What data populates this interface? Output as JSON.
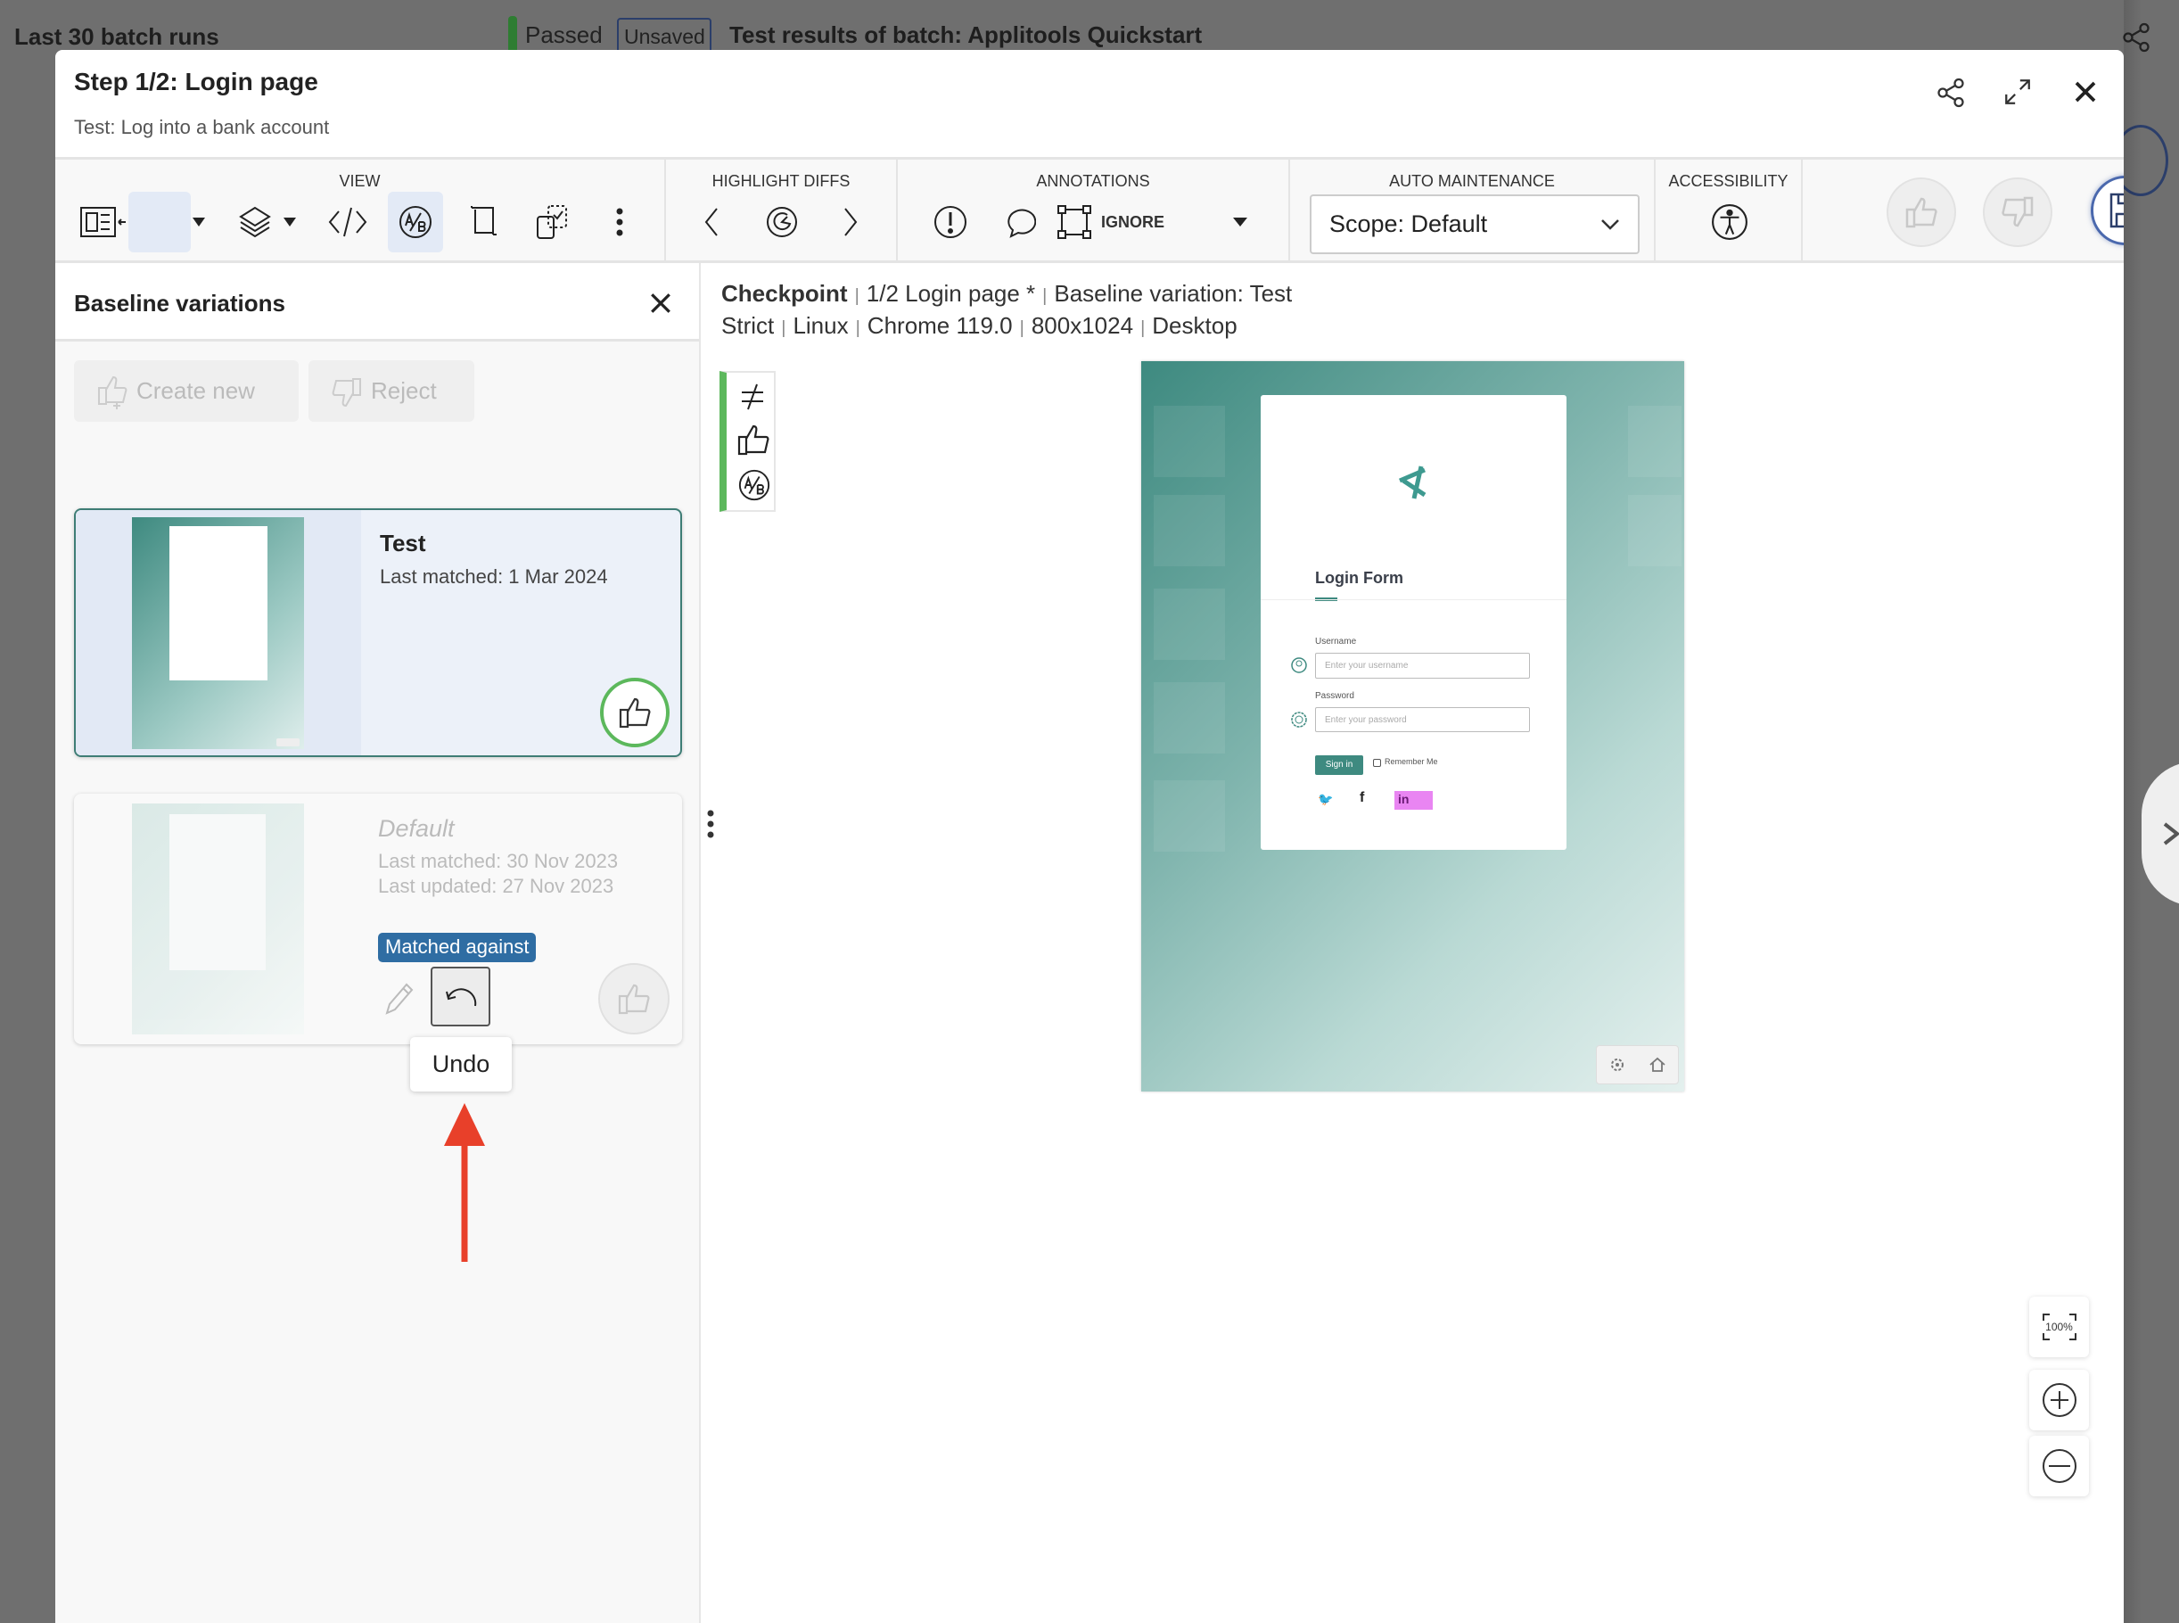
{
  "background": {
    "left_title": "Last 30 batch runs",
    "status": "Passed",
    "unsaved_badge": "Unsaved",
    "batch_title": "Test results of batch:  Applitools Quickstart"
  },
  "header": {
    "title": "Step 1/2:  Login page",
    "subtitle": "Test: Log into a bank account"
  },
  "toolbar": {
    "view_label": "VIEW",
    "highlight_label": "HIGHLIGHT DIFFS",
    "annotations_label": "ANNOTATIONS",
    "ignore_label": "IGNORE",
    "auto_maintenance_label": "AUTO MAINTENANCE",
    "scope_value": "Scope: Default",
    "accessibility_label": "ACCESSIBILITY"
  },
  "baseline_panel": {
    "title": "Baseline variations",
    "create_new": "Create new",
    "reject": "Reject",
    "variations": [
      {
        "name": "Test",
        "last_matched": "Last matched: 1 Mar 2024"
      },
      {
        "name": "Default",
        "last_matched": "Last matched: 30 Nov 2023",
        "last_updated": "Last updated: 27 Nov 2023",
        "badge": "Matched against"
      }
    ],
    "tooltip": "Undo"
  },
  "checkpoint": {
    "label": "Checkpoint",
    "step": "1/2 Login page *",
    "variation": "Baseline variation: Test",
    "match_level": "Strict",
    "os": "Linux",
    "browser": "Chrome 119.0",
    "viewport": "800x1024",
    "device": "Desktop"
  },
  "preview": {
    "form_title": "Login Form",
    "username_label": "Username",
    "username_placeholder": "Enter your username",
    "password_label": "Password",
    "password_placeholder": "Enter your password",
    "sign_in": "Sign in",
    "remember_me": "Remember Me"
  },
  "zoom": {
    "fit_label": "100%"
  },
  "colors": {
    "accent_green": "#5cb85c",
    "teal": "#3e8a80",
    "badge_blue": "#2f6da3",
    "arrow_red": "#e8402a",
    "diff_magenta": "#e37ef0"
  }
}
